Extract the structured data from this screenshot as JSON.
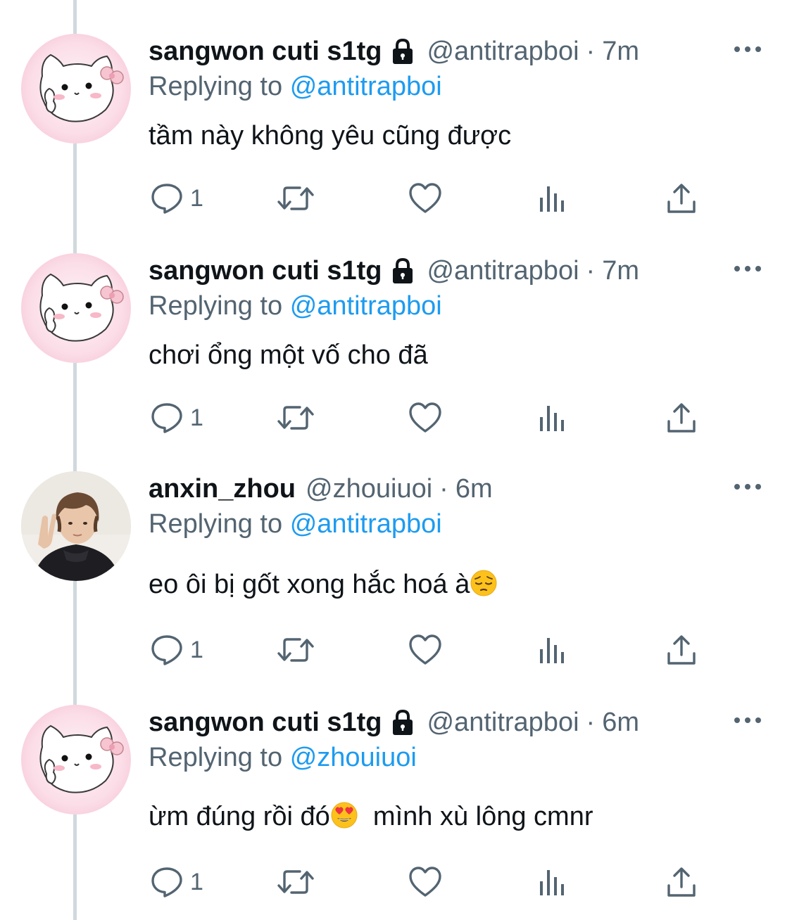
{
  "colors": {
    "text": "#0f1419",
    "secondary": "#536471",
    "link": "#1d9bf0",
    "thread_line": "#cfd9de"
  },
  "tweets": [
    {
      "name": "sangwon cuti s1tg",
      "protected": true,
      "handle": "@antitrapboi",
      "time": "7m",
      "reply_prefix": "Replying to",
      "reply_target": "@antitrapboi",
      "text": "tầm này không yêu cũng được",
      "emoji": "",
      "text_after": "",
      "avatar": "pink-cat-avatar",
      "reply_count": "1"
    },
    {
      "name": "sangwon cuti s1tg",
      "protected": true,
      "handle": "@antitrapboi",
      "time": "7m",
      "reply_prefix": "Replying to",
      "reply_target": "@antitrapboi",
      "text": "chơi ổng một vố cho đã",
      "emoji": "",
      "text_after": "",
      "avatar": "pink-cat-avatar",
      "reply_count": "1"
    },
    {
      "name": "anxin_zhou",
      "protected": false,
      "handle": "@zhouiuoi",
      "time": "6m",
      "reply_prefix": "Replying to",
      "reply_target": "@antitrapboi",
      "text": "eo ôi bị gốt xong hắc hoá à",
      "emoji": "pensive-face-emoji",
      "text_after": "",
      "avatar": "photo-avatar",
      "reply_count": "1"
    },
    {
      "name": "sangwon cuti s1tg",
      "protected": true,
      "handle": "@antitrapboi",
      "time": "6m",
      "reply_prefix": "Replying to",
      "reply_target": "@zhouiuoi",
      "text": "ừm đúng rồi đó",
      "emoji": "heart-eyes-emoji",
      "text_after": "  mình xù lông cmnr",
      "avatar": "pink-cat-avatar",
      "reply_count": "1"
    }
  ],
  "separator": "·",
  "icons": {
    "more": "more-dots-icon",
    "lock": "lock-icon",
    "reply": "reply-icon",
    "retweet": "retweet-icon",
    "like": "heart-icon",
    "views": "views-chart-icon",
    "share": "share-icon"
  }
}
